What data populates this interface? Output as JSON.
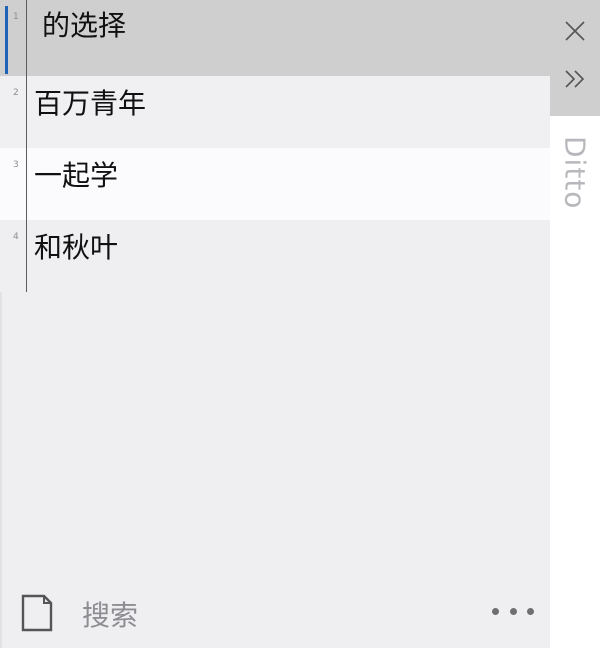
{
  "clips": [
    {
      "index": "1",
      "text": "的选择"
    },
    {
      "index": "2",
      "text": "百万青年"
    },
    {
      "index": "3",
      "text": "一起学"
    },
    {
      "index": "4",
      "text": "和秋叶"
    }
  ],
  "side": {
    "title": "Ditto",
    "close_icon": "close-icon",
    "collapse_icon": "double-chevron-right-icon"
  },
  "footer": {
    "search_label": "搜索",
    "note_icon": "note-icon",
    "more_icon": "more-dots-icon"
  },
  "colors": {
    "selection_accent": "#1e63b8",
    "selected_row": "#cfcfcf",
    "panel": "#efeef1"
  }
}
